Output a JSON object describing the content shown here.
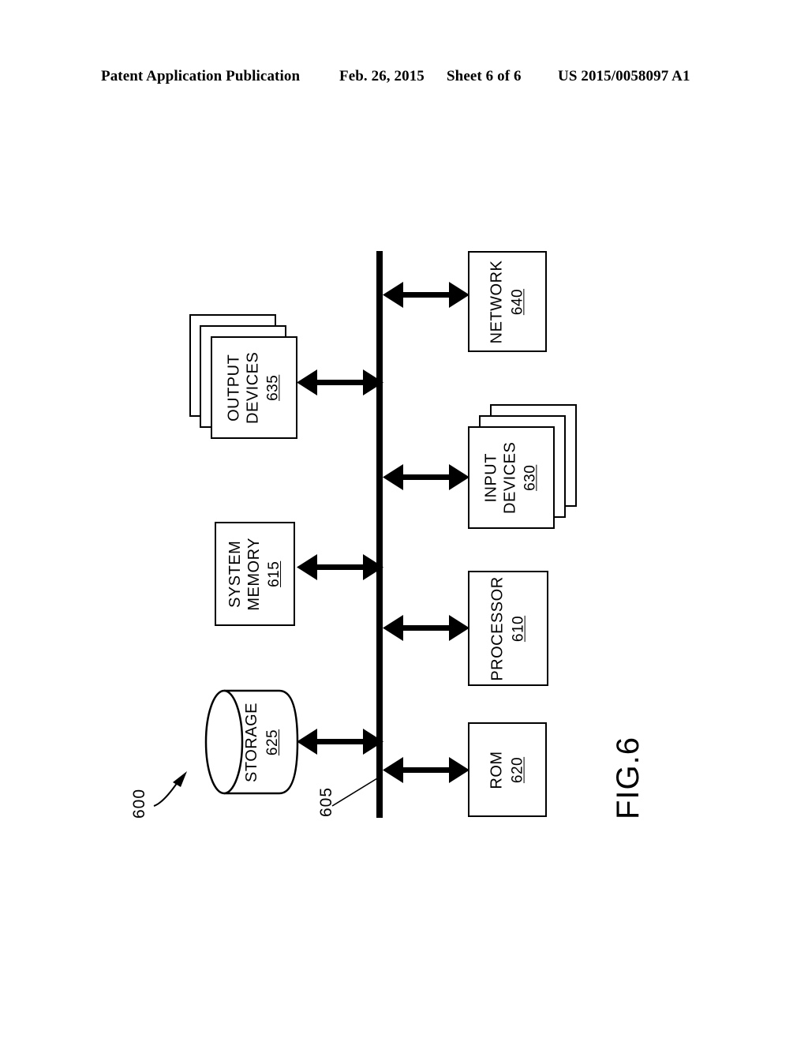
{
  "header": {
    "publication": "Patent Application Publication",
    "date": "Feb. 26, 2015",
    "sheet": "Sheet 6 of 6",
    "patent_number": "US 2015/0058097 A1"
  },
  "figure": {
    "caption": "FIG.6",
    "system_ref": "600",
    "bus_ref": "605",
    "nodes": [
      {
        "id": "network",
        "title": "NETWORK",
        "ref": "640",
        "shape": "rect",
        "side": "right"
      },
      {
        "id": "output-devices",
        "title_line1": "OUTPUT",
        "title_line2": "DEVICES",
        "ref": "635",
        "shape": "stack",
        "side": "left"
      },
      {
        "id": "input-devices",
        "title_line1": "INPUT",
        "title_line2": "DEVICES",
        "ref": "630",
        "shape": "stack",
        "side": "right"
      },
      {
        "id": "system-memory",
        "title_line1": "SYSTEM",
        "title_line2": "MEMORY",
        "ref": "615",
        "shape": "rect",
        "side": "left"
      },
      {
        "id": "processor",
        "title": "PROCESSOR",
        "ref": "610",
        "shape": "rect",
        "side": "right"
      },
      {
        "id": "storage",
        "title": "STORAGE",
        "ref": "625",
        "shape": "cylinder",
        "side": "left"
      },
      {
        "id": "rom",
        "title": "ROM",
        "ref": "620",
        "shape": "rect",
        "side": "right"
      }
    ],
    "colors": {
      "ink": "#000000",
      "paper": "#ffffff"
    }
  }
}
